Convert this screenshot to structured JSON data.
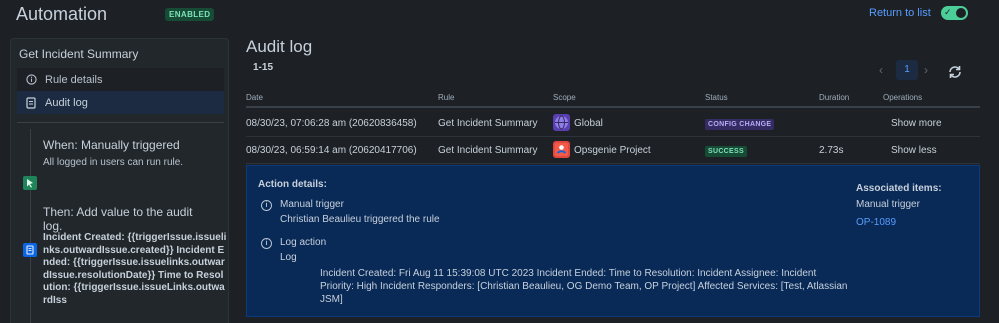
{
  "header": {
    "title": "Automation",
    "status_badge": "ENABLED",
    "return_link": "Return to list",
    "toggle_on": true,
    "toggle_check": "✓"
  },
  "sidebar": {
    "title": "Get Incident Summary",
    "nav": [
      {
        "label": "Rule details",
        "icon": "info-icon",
        "active": false
      },
      {
        "label": "Audit log",
        "icon": "document-icon",
        "active": true
      }
    ],
    "trigger": {
      "title": "When: Manually triggered",
      "subtitle": "All logged in users can run rule."
    },
    "action": {
      "title": "Then: Add value to the audit log.",
      "code": "Incident Created: {{triggerIssue.issuelinks.outwardIssue.created}} Incident Ended: {{triggerIssue.issuelinks.outwardIssue.resolutionDate}} Time to Resolution: {{triggerIssue.issueLinks.outwardIss"
    }
  },
  "main": {
    "title": "Audit log",
    "range": "1-15",
    "pagination": {
      "prev": "‹",
      "current": "1",
      "next": "›"
    },
    "columns": [
      "Date",
      "Rule",
      "Scope",
      "Status",
      "Duration",
      "Operations"
    ],
    "rows": [
      {
        "date": "08/30/23, 07:06:28 am (20620836458)",
        "rule": "Get Incident Summary",
        "scope": "Global",
        "scope_icon": "globe-icon",
        "status": "CONFIG CHANGE",
        "duration": "",
        "operation": "Show more"
      },
      {
        "date": "08/30/23, 06:59:14 am (20620417706)",
        "rule": "Get Incident Summary",
        "scope": "Opsgenie Project",
        "scope_icon": "opsgenie-icon",
        "status": "SUCCESS",
        "duration": "2.73s",
        "operation": "Show less"
      }
    ],
    "details": {
      "title": "Action details:",
      "trigger_label": "Manual trigger",
      "trigger_text": "Christian Beaulieu triggered the rule",
      "log_label": "Log action",
      "log_sub": "Log",
      "log_body": "Incident Created: Fri Aug 11 15:39:08 UTC 2023 Incident Ended: Time to Resolution: Incident Assignee: Incident Priority: High Incident Responders: [Christian Beaulieu, OG Demo Team, OP Project] Affected Services: [Test, Atlassian JSM]",
      "assoc_title": "Associated items:",
      "assoc_trigger": "Manual trigger",
      "assoc_link": "OP-1089"
    }
  },
  "colors": {
    "background": "#1d2125",
    "accent": "#579dff",
    "success": "#4bce97",
    "details_bg": "#092957"
  }
}
